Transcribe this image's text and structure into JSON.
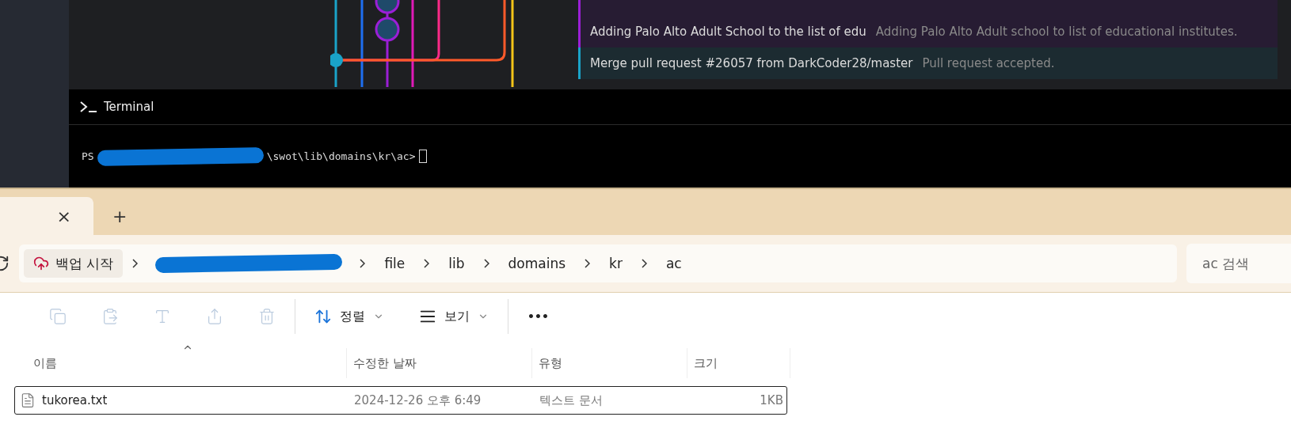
{
  "commits": [
    {
      "title": "Adding Palo Alto Adult School to the list of edu",
      "message": "Adding Palo Alto Adult school to list of educational institutes.",
      "color": "#9b1fd6",
      "kind": "avatar",
      "selected": false
    },
    {
      "title": "Merge pull request #26057 from DarkCoder28/master",
      "message": "Pull request accepted.",
      "color": "#1aa3c8",
      "kind": "merge",
      "selected": true
    }
  ],
  "terminal": {
    "title": "Terminal",
    "prompt_prefix": "PS",
    "prompt_path": "\\swot\\lib\\domains\\kr\\ac>"
  },
  "explorer": {
    "tab_close": "×",
    "new_tab": "+",
    "breadcrumbs": [
      {
        "label": "백업 시작",
        "kind": "backup"
      },
      {
        "kind": "redacted"
      },
      {
        "label": "file",
        "kind": "folder"
      },
      {
        "label": "lib",
        "kind": "folder"
      },
      {
        "label": "domains",
        "kind": "folder"
      },
      {
        "label": "kr",
        "kind": "folder"
      },
      {
        "label": "ac",
        "kind": "folder"
      }
    ],
    "search": {
      "placeholder": "ac 검색"
    },
    "toolbar": [
      {
        "kind": "copy",
        "disabled": true
      },
      {
        "kind": "paste",
        "disabled": true
      },
      {
        "kind": "rename",
        "disabled": true
      },
      {
        "kind": "share",
        "disabled": true
      },
      {
        "kind": "delete",
        "disabled": true
      },
      {
        "kind": "sort",
        "label": "정렬"
      },
      {
        "kind": "view",
        "label": "보기"
      },
      {
        "kind": "more",
        "label": "•••"
      }
    ],
    "columns": [
      "이름",
      "수정한 날짜",
      "유형",
      "크기"
    ],
    "files": [
      {
        "name": "tukorea.txt",
        "modified": "2024-12-26 오후 6:49",
        "type": "텍스트 문서",
        "size": "1KB",
        "selected": true
      }
    ]
  }
}
